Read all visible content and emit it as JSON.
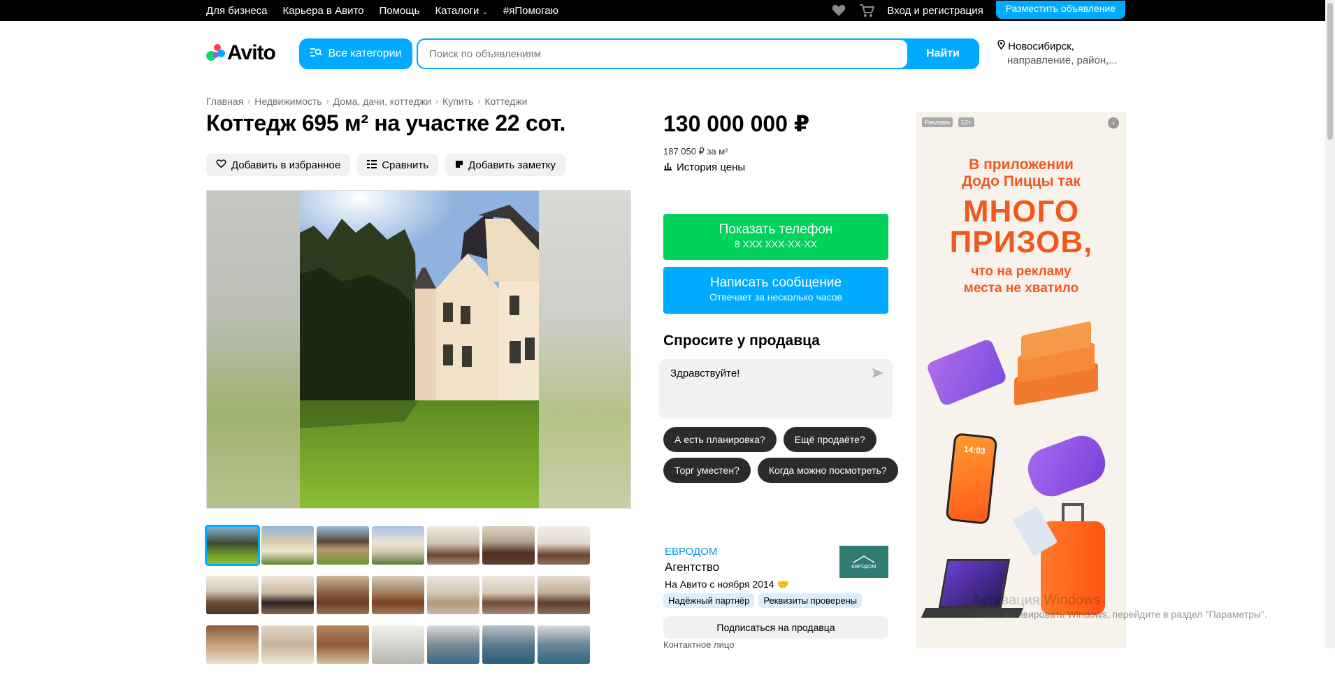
{
  "topbar": {
    "links": [
      "Для бизнеса",
      "Карьера в Авито",
      "Помощь",
      "Каталоги",
      "#яПомогаю"
    ],
    "login": "Вход и регистрация",
    "post_ad": "Разместить объявление"
  },
  "header": {
    "logo": "Avito",
    "categories_button": "Все категории",
    "search_placeholder": "Поиск по объявлениям",
    "search_button": "Найти",
    "location_city": "Новосибирск,",
    "location_sub": "направление, район,..."
  },
  "breadcrumbs": [
    "Главная",
    "Недвижимость",
    "Дома, дачи, коттеджи",
    "Купить",
    "Коттеджи"
  ],
  "listing": {
    "title": "Коттедж 695 м² на участке 22 сот.",
    "actions": [
      "Добавить в избранное",
      "Сравнить",
      "Добавить заметку"
    ],
    "price": "130 000 000 ₽",
    "price_per_m2": "187 050 ₽ за м²",
    "price_history": "История цены"
  },
  "contact": {
    "show_phone": "Показать телефон",
    "phone_masked": "8 XXX XXX-XX-XX",
    "write_message": "Написать сообщение",
    "reply_time": "Отвечает за несколько часов",
    "ask_title": "Спросите у продавца",
    "ask_text": "Здравствуйте!",
    "quick_questions": [
      "А есть планировка?",
      "Ещё продаёте?",
      "Торг уместен?",
      "Когда можно посмотреть?"
    ]
  },
  "seller": {
    "name": "ЕВРОДОМ",
    "type": "Агентство",
    "since": "На Авито с ноября 2014",
    "logo_text": "ЕВРОДОМ",
    "badges": [
      "Надёжный партнёр",
      "Реквизиты проверены"
    ],
    "subscribe": "Подписаться на продавца",
    "contact_person": "Контактное лицо"
  },
  "ad": {
    "tag": "Реклама",
    "age": "12+",
    "line1": "В приложении",
    "line2": "Додо Пиццы так",
    "big1": "МНОГО",
    "big2": "ПРИЗОВ,",
    "line3": "что на рекламу",
    "line4": "места не хватило",
    "phone_time": "14:03"
  },
  "watermark": {
    "title": "Активация Windows",
    "text": "Чтобы активировать Windows, перейдите в раздел \"Параметры\"."
  }
}
